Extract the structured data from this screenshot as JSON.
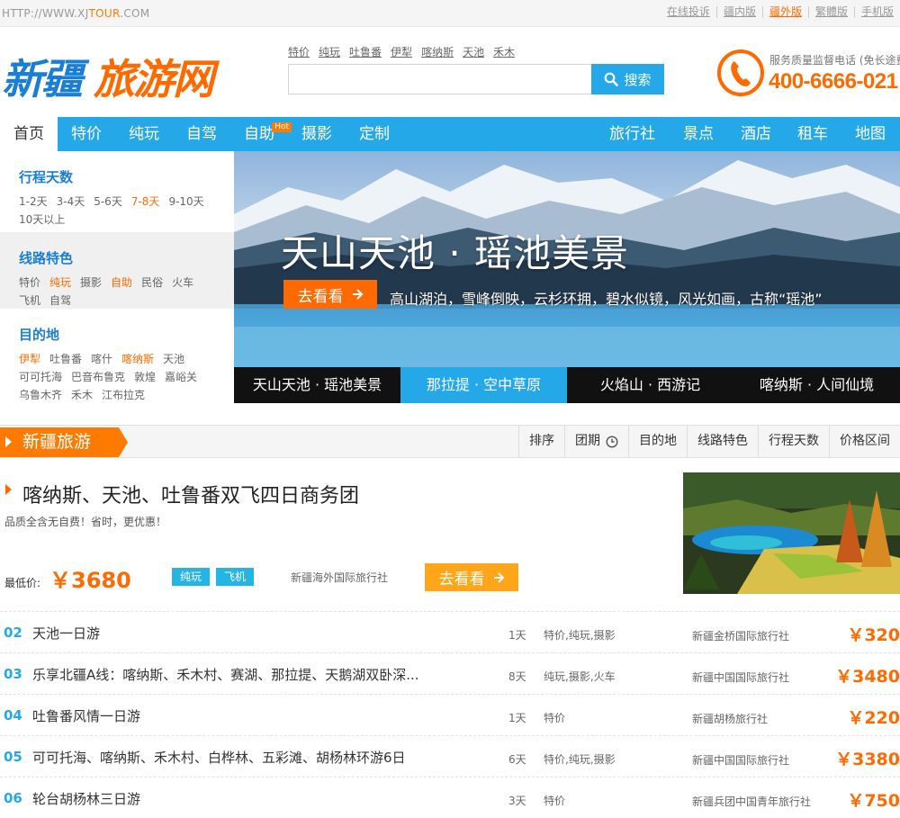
{
  "topbar": {
    "url_prefix": "HTTP://WWW.XJ",
    "url_accent": "TOUR",
    "url_suffix": ".COM",
    "links": [
      {
        "label": "在线投诉"
      },
      {
        "label": "疆内版"
      },
      {
        "label": "疆外版",
        "active": true
      },
      {
        "label": "繁體版"
      },
      {
        "label": "手机版"
      }
    ]
  },
  "logo": {
    "part1": "新疆",
    "part2": "旅游网"
  },
  "search": {
    "hotwords": [
      "特价",
      "纯玩",
      "吐鲁番",
      "伊犁",
      "喀纳斯",
      "天池",
      "禾木"
    ],
    "value": "",
    "button_label": "搜索"
  },
  "hotline": {
    "label": "服务质量监督电话 (免长途费)",
    "number": "400-6666-021"
  },
  "nav": {
    "home": "首页",
    "left": [
      "特价",
      "纯玩",
      "自驾",
      "自助",
      "摄影",
      "定制"
    ],
    "hot_badge": "Hot",
    "right": [
      "旅行社",
      "景点",
      "酒店",
      "租车",
      "地图"
    ]
  },
  "filter": {
    "groups": [
      {
        "title": "行程天数",
        "options": [
          "1-2天",
          "3-4天",
          "5-6天",
          "7-8天",
          "9-10天",
          "10天以上"
        ],
        "highlight": [
          "7-8天"
        ]
      },
      {
        "title": "线路特色",
        "options": [
          "特价",
          "纯玩",
          "摄影",
          "自助",
          "民俗",
          "火车",
          "飞机",
          "自驾"
        ],
        "highlight": [
          "纯玩",
          "自助"
        ]
      },
      {
        "title": "目的地",
        "options": [
          "伊犁",
          "吐鲁番",
          "喀什",
          "喀纳斯",
          "天池",
          "可可托海",
          "巴音布鲁克",
          "敦煌",
          "嘉峪关",
          "乌鲁木齐",
          "禾木",
          "江布拉克"
        ],
        "highlight": [
          "伊犁",
          "喀纳斯"
        ]
      }
    ]
  },
  "banner": {
    "title": "天山天池 · 瑶池美景",
    "button_label": "去看看",
    "description": "高山湖泊，雪峰倒映，云杉环拥，碧水似镜，风光如画，古称“瑶池”",
    "tabs": [
      "天山天池 · 瑶池美景",
      "那拉提 · 空中草原",
      "火焰山 · 西游记",
      "喀纳斯 · 人间仙境"
    ],
    "active_tab": 1
  },
  "section": {
    "title": "新疆旅游",
    "sorts": [
      "排序",
      "团期",
      "目的地",
      "线路特色",
      "行程天数",
      "价格区间"
    ]
  },
  "featured": {
    "title": "喀纳斯、天池、吐鲁番双飞四日商务团",
    "subtitle": "品质全含无自费！省时，更优惠！",
    "price_label": "最低价:",
    "price": "￥3680",
    "tags": [
      "纯玩",
      "飞机"
    ],
    "agency": "新疆海外国际旅行社",
    "button_label": "去看看"
  },
  "routes": [
    {
      "no": "02",
      "name": "天池一日游",
      "days": "1天",
      "features": "特价,纯玩,摄影",
      "agency": "新疆金桥国际旅行社",
      "price": "￥320"
    },
    {
      "no": "03",
      "name": "乐享北疆A线：喀纳斯、禾木村、赛湖、那拉提、天鹅湖双卧深...",
      "days": "8天",
      "features": "纯玩,摄影,火车",
      "agency": "新疆中国国际旅行社",
      "price": "￥3480"
    },
    {
      "no": "04",
      "name": "吐鲁番风情一日游",
      "days": "1天",
      "features": "特价",
      "agency": "新疆胡杨旅行社",
      "price": "￥220"
    },
    {
      "no": "05",
      "name": "可可托海、喀纳斯、禾木村、白桦林、五彩滩、胡杨林环游6日",
      "days": "6天",
      "features": "特价,纯玩,摄影",
      "agency": "新疆中国国际旅行社",
      "price": "￥3380"
    },
    {
      "no": "06",
      "name": "轮台胡杨林三日游",
      "days": "3天",
      "features": "特价",
      "agency": "新疆兵团中国青年旅行社",
      "price": "￥750"
    }
  ]
}
